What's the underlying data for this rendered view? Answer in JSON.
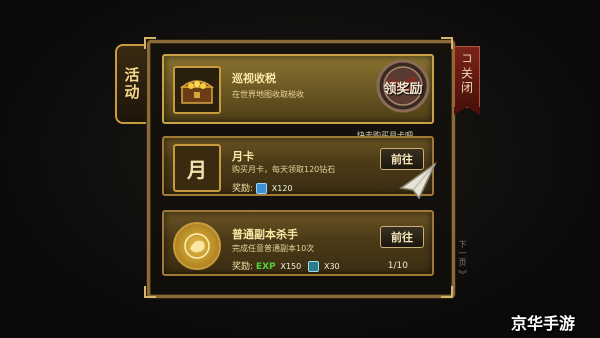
{
  "side_tab": {
    "label": "活动"
  },
  "close_tab": {
    "label": "关闭",
    "glyph": "コ"
  },
  "hint": "快去购买月卡吧",
  "cards": [
    {
      "title": "巡视收税",
      "desc": "在世界地图收取税收",
      "icon": "treasure-chest-icon",
      "stamp_text": "领奖励"
    },
    {
      "title": "月卡",
      "desc": "购买月卡，每天领取120钻石",
      "icon": "month-card-icon",
      "icon_text": "月",
      "reward_label": "奖励:",
      "reward_value": "X120",
      "button": "前往"
    },
    {
      "title": "普通副本杀手",
      "desc": "完成任意普通副本10次",
      "icon": "lion-medal-icon",
      "reward_label": "奖励:",
      "exp_label": "EXP",
      "exp_value": "X150",
      "reward_value": "X30",
      "progress": "1/10",
      "button": "前往"
    }
  ],
  "scroll": {
    "label": "下一页",
    "arrow": "︾"
  },
  "watermark": "京华手游",
  "colors": {
    "gold": "#c9a24a",
    "exp": "#53d13a",
    "ribbon": "#7b2419"
  }
}
